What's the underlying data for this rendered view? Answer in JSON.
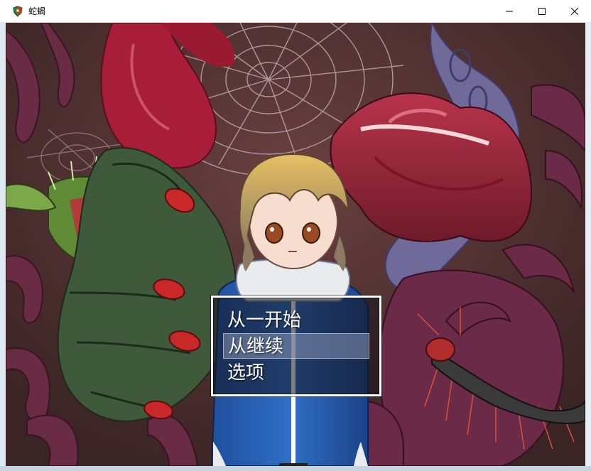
{
  "window": {
    "title": "蛇蝎",
    "icon": "game-shield-icon"
  },
  "caption_buttons": {
    "minimize": "minimize-icon",
    "maximize": "maximize-icon",
    "close": "close-icon"
  },
  "title_menu": {
    "items": [
      {
        "label": "从一开始",
        "selected": false
      },
      {
        "label": "从继续",
        "selected": true
      },
      {
        "label": "选项",
        "selected": false
      }
    ]
  },
  "colors": {
    "window_frame": "#ffffff",
    "menu_text": "#ffffff",
    "cursor_highlight": "#a0aac8"
  }
}
